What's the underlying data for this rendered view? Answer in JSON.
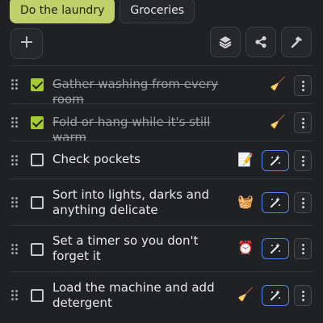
{
  "tabs": [
    {
      "label": "Do the laundry",
      "active": true
    },
    {
      "label": "Groceries",
      "active": false
    }
  ],
  "toolbar": {
    "add_label": "+",
    "icons": [
      "layers-icon",
      "share-icon",
      "hammer-icon"
    ]
  },
  "items": [
    {
      "text": "Gather washing from every room",
      "checked": true,
      "emoji": "🧹",
      "magic": false
    },
    {
      "text": "Fold or hang while it's still warm",
      "checked": true,
      "emoji": "🧹",
      "magic": false
    },
    {
      "text": "Check pockets",
      "checked": false,
      "emoji": "📝",
      "magic": true
    },
    {
      "text": "Sort into lights, darks and anything delicate",
      "checked": false,
      "emoji": "🧺",
      "magic": true
    },
    {
      "text": "Set a timer so you don't forget it",
      "checked": false,
      "emoji": "⏰",
      "magic": true
    },
    {
      "text": "Load the machine and add detergent",
      "checked": false,
      "emoji": "🧹",
      "magic": true
    }
  ],
  "colors": {
    "background": "#202124",
    "active_tab": "#c0d06a",
    "checkbox_checked": "#a6cb32",
    "magic_border": "#4f86f0"
  }
}
